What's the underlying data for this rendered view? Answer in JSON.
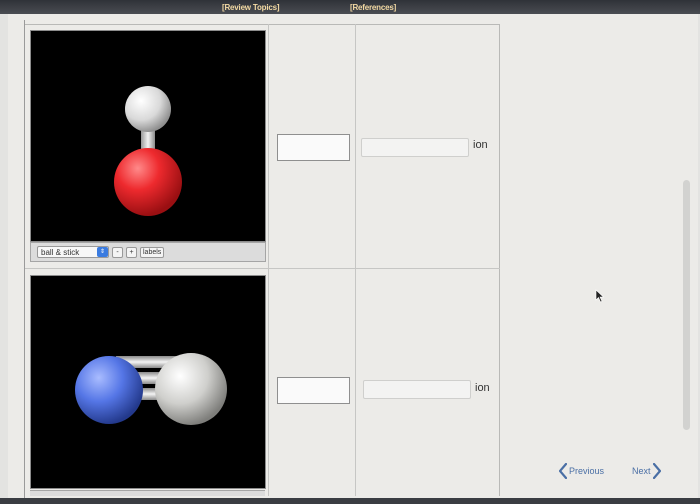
{
  "header": {
    "review_topics": "[Review Topics]",
    "references": "[References]"
  },
  "rows": [
    {
      "viewer": {
        "molecule": "hydroxide",
        "atoms": [
          "white-atom",
          "red-atom"
        ]
      },
      "toolbar": {
        "display_mode": "ball & stick",
        "minus": "-",
        "plus": "+",
        "labels": "labels"
      },
      "answer_value": "",
      "ion_select": "",
      "ion_label": "ion"
    },
    {
      "viewer": {
        "molecule": "cyanide",
        "atoms": [
          "blue-atom",
          "gray-atom"
        ]
      },
      "answer_value": "",
      "ion_select": "",
      "ion_label": "ion"
    }
  ],
  "nav": {
    "previous": "Previous",
    "next": "Next",
    "accent": "#4a6fa5"
  },
  "colors": {
    "oxygen": "#e8262a",
    "hydrogen": "#e9e9e9",
    "nitrogen": "#5576e6",
    "carbon": "#c9c9c6"
  }
}
